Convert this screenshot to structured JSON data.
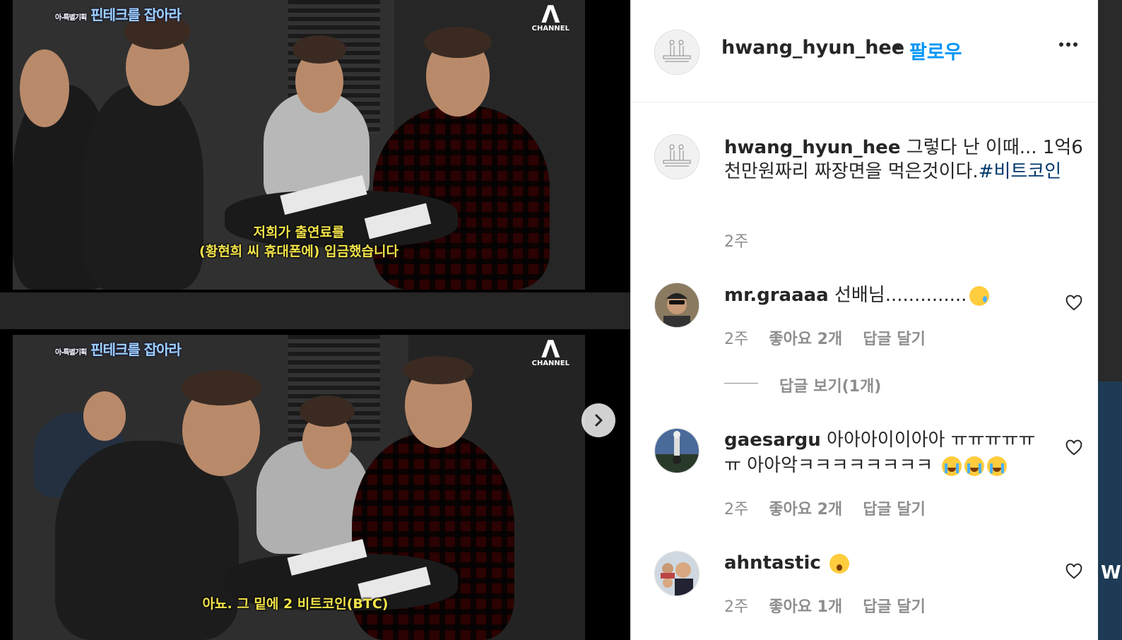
{
  "media": {
    "top_frame": {
      "show_logo_small": "아-특별기획",
      "show_logo": "핀테크를 잡아라",
      "channel": "CHANNEL",
      "subtitle_line1": "저희가 출연료를",
      "subtitle_line2": "(황현희 씨 휴대폰에) 입금했습니다"
    },
    "bottom_frame": {
      "show_logo_small": "아-특별기획",
      "show_logo": "핀테크를 잡아라",
      "channel": "CHANNEL",
      "subtitle_line1": "아뇨. 그 밑에 2 비트코인(BTC)"
    },
    "next_icon": "chevron-right-icon"
  },
  "post": {
    "header": {
      "username": "hwang_hyun_hee",
      "separator": "•",
      "follow_label": "팔로우",
      "more_icon": "more-horizontal-icon"
    },
    "caption": {
      "username": "hwang_hyun_hee",
      "text": "그렇다 난 이때... 1억6천만원짜리 짜장면을 먹은것이다.",
      "hashtag": "#비트코인",
      "time": "2주"
    },
    "comments": [
      {
        "username": "mr.graaaa",
        "text": "선배님..............",
        "emoji": [
          "crying-face"
        ],
        "time": "2주",
        "likes": "좋아요 2개",
        "reply_label": "답글 달기"
      },
      {
        "username": "gaesargu",
        "text": "아아아이이아아 ㅠㅠㅠㅠㅠㅠ 아아악ㅋㅋㅋㅋㅋㅋㅋㅋ",
        "emoji": [
          "loudly-crying-face",
          "loudly-crying-face",
          "loudly-crying-face"
        ],
        "time": "2주",
        "likes": "좋아요 2개",
        "reply_label": "답글 달기"
      },
      {
        "username": "ahntastic",
        "text": "",
        "emoji": [
          "face-with-open-mouth"
        ],
        "time": "2주",
        "likes": "좋아요 1개",
        "reply_label": "답글 달기"
      }
    ],
    "view_replies_label": "답글 보기(1개)",
    "colors": {
      "link_blue": "#0095f6",
      "hashtag_blue": "#00376b",
      "muted_gray": "#8e8e8e",
      "text_dark": "#262626"
    }
  }
}
